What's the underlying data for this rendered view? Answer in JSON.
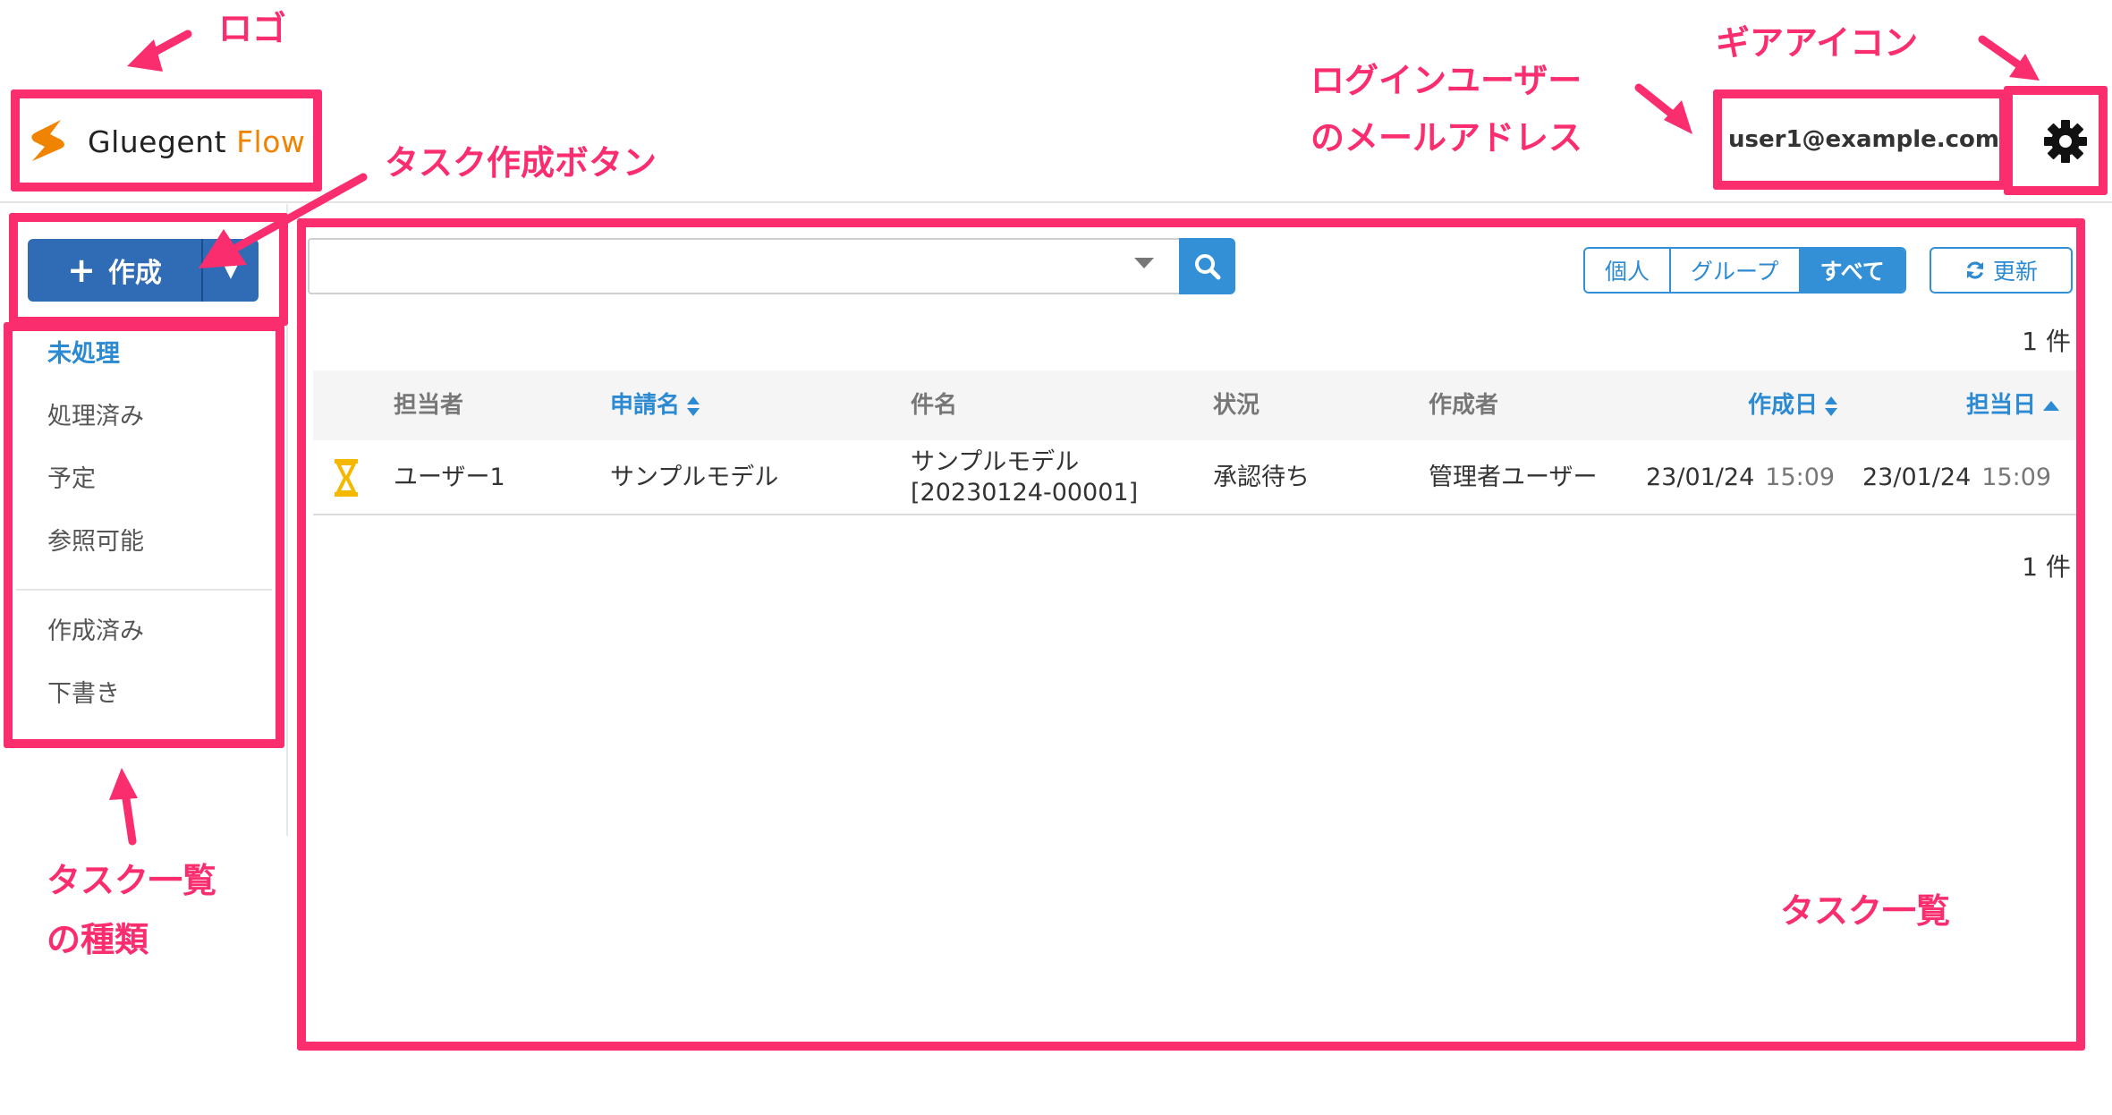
{
  "logo": {
    "brand": "Gluegent",
    "product": "Flow"
  },
  "header": {
    "user_email": "user1@example.com"
  },
  "create_button": {
    "label": "作成"
  },
  "sidebar": {
    "items": [
      {
        "label": "未処理",
        "active": true
      },
      {
        "label": "処理済み"
      },
      {
        "label": "予定"
      },
      {
        "label": "参照可能"
      }
    ],
    "items_secondary": [
      {
        "label": "作成済み"
      },
      {
        "label": "下書き"
      }
    ]
  },
  "toolbar": {
    "scope_options": [
      "個人",
      "グループ",
      "すべて"
    ],
    "scope_selected": "すべて",
    "refresh_label": "更新"
  },
  "count_label": "1 件",
  "table": {
    "columns": [
      "担当者",
      "申請名",
      "件名",
      "状況",
      "作成者",
      "作成日",
      "担当日"
    ],
    "rows": [
      {
        "assignee": "ユーザー1",
        "application": "サンプルモデル",
        "subject_line1": "サンプルモデル",
        "subject_line2": "[20230124-00001]",
        "status": "承認待ち",
        "creator": "管理者ユーザー",
        "created_date": "23/01/24",
        "created_time": "15:09",
        "assigned_date": "23/01/24",
        "assigned_time": "15:09"
      }
    ]
  },
  "annotations": {
    "logo": "ロゴ",
    "create_button": "タスク作成ボタン",
    "user_email_line1": "ログインユーザー",
    "user_email_line2": "のメールアドレス",
    "gear": "ギアアイコン",
    "task_types_line1": "タスク一覧",
    "task_types_line2": "の種類",
    "task_list": "タスク一覧"
  },
  "colors": {
    "annotation": "#fa2d6e",
    "primary": "#2f6cb5",
    "accent_blue": "#3490d6",
    "logo_orange": "#f08300",
    "pending_icon": "#f5b800"
  }
}
